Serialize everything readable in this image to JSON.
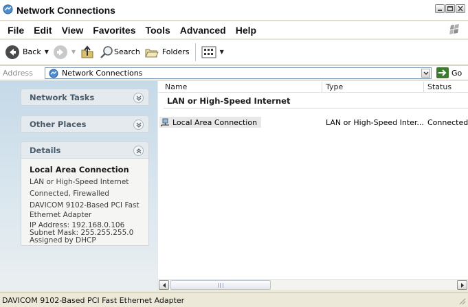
{
  "window": {
    "title": "Network Connections"
  },
  "menu": [
    "File",
    "Edit",
    "View",
    "Favorites",
    "Tools",
    "Advanced",
    "Help"
  ],
  "toolbar": {
    "back_label": "Back",
    "search_label": "Search",
    "folders_label": "Folders"
  },
  "address": {
    "label": "Address",
    "value": "Network Connections",
    "go_label": "Go"
  },
  "leftpane": {
    "network_tasks": "Network Tasks",
    "other_places": "Other Places",
    "details": {
      "header": "Details",
      "title": "Local Area Connection",
      "lines": [
        "LAN or High-Speed Internet",
        "Connected, Firewalled",
        "DAVICOM 9102-Based PCI Fast Ethernet Adapter",
        "IP Address: 192.168.0.106",
        "Subnet Mask: 255.255.255.0",
        "Assigned by DHCP"
      ]
    }
  },
  "list": {
    "columns": [
      "Name",
      "Type",
      "Status"
    ],
    "group": "LAN or High-Speed Internet",
    "rows": [
      {
        "name": "Local Area Connection",
        "type": "LAN or High-Speed Inter...",
        "status": "Connected"
      }
    ]
  },
  "statusbar": {
    "text": "DAVICOM 9102-Based PCI Fast Ethernet Adapter"
  },
  "colors": {
    "titlebar": "#ffffff",
    "pane_gradient_top": "#c5d9e8",
    "group_header_text": "#4a5b6a",
    "go_green": "#3c7a2f"
  }
}
